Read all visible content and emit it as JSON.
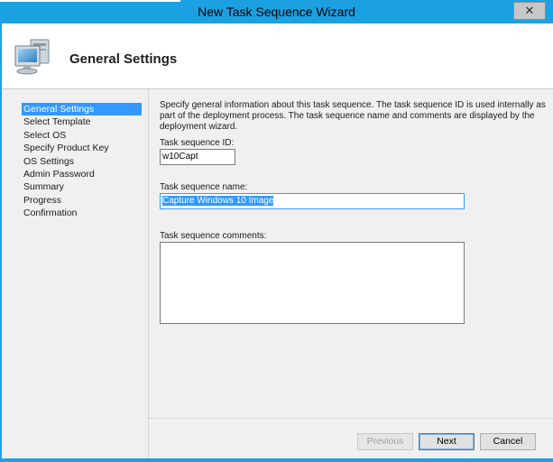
{
  "window": {
    "title": "New Task Sequence Wizard",
    "close_glyph": "✕"
  },
  "header": {
    "heading": "General Settings",
    "icon": "computer-icon"
  },
  "steps": [
    {
      "label": "General Settings",
      "active": true
    },
    {
      "label": "Select Template",
      "active": false
    },
    {
      "label": "Select OS",
      "active": false
    },
    {
      "label": "Specify Product Key",
      "active": false
    },
    {
      "label": "OS Settings",
      "active": false
    },
    {
      "label": "Admin Password",
      "active": false
    },
    {
      "label": "Summary",
      "active": false
    },
    {
      "label": "Progress",
      "active": false
    },
    {
      "label": "Confirmation",
      "active": false
    }
  ],
  "form": {
    "description": "Specify general information about this task sequence.  The task sequence ID is used internally as part of the deployment process.  The task sequence name and comments are displayed by the deployment wizard.",
    "id_label": "Task sequence ID:",
    "id_value": "w10Capt",
    "name_label": "Task sequence name:",
    "name_value": "Capture Windows 10 Image",
    "comments_label": "Task sequence comments:",
    "comments_value": ""
  },
  "buttons": {
    "previous": "Previous",
    "next": "Next",
    "cancel": "Cancel"
  },
  "colors": {
    "accent": "#1ba1e2",
    "selection": "#3399ff"
  }
}
